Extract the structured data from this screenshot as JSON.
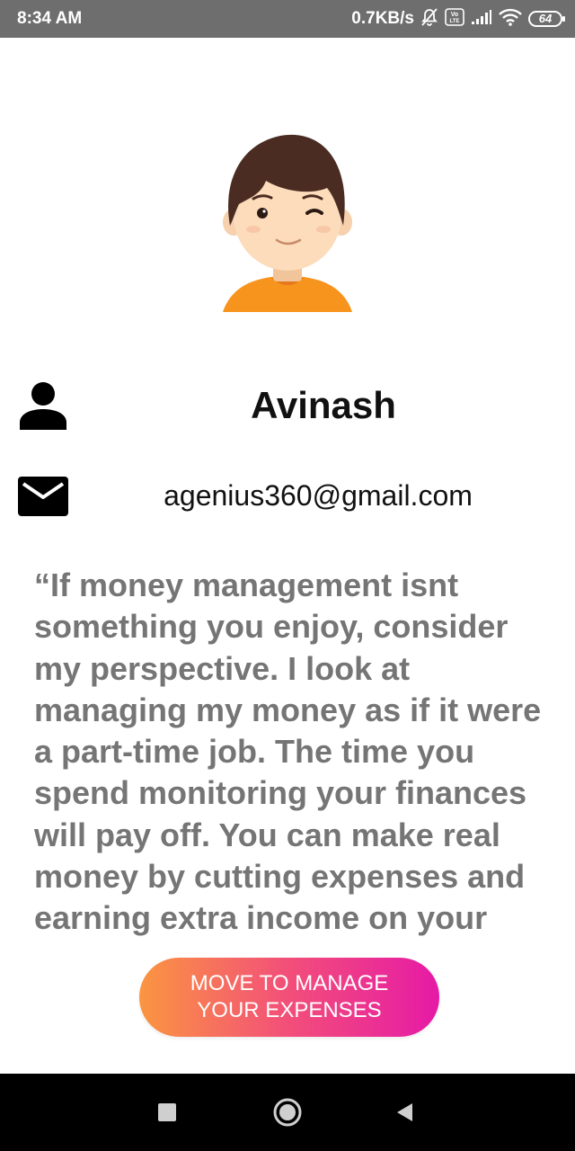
{
  "status_bar": {
    "time": "8:34 AM",
    "network_speed": "0.7KB/s",
    "volte_badge": "VoLTE",
    "battery_level": "64",
    "icons": [
      "mute-notification-icon",
      "volte-icon",
      "signal-icon",
      "wifi-icon",
      "battery-icon"
    ]
  },
  "profile": {
    "avatar_icon": "boy-avatar",
    "name": "Avinash",
    "email": "agenius360@gmail.com",
    "name_icon": "person-icon",
    "email_icon": "mail-icon"
  },
  "quote": {
    "text": "“If money management isnt something you enjoy, consider my perspective. I look at managing my money as if it were a part-time job. The time you spend monitoring your finances will pay off. You can make real money by cutting expenses and earning extra income on your spare time.”"
  },
  "cta": {
    "label": "MOVE TO MANAGE YOUR EXPENSES",
    "gradient": [
      "#fb9541",
      "#f24e7a",
      "#e61aa6"
    ]
  },
  "nav_bar": {
    "buttons": [
      "recents-button",
      "home-button",
      "back-button"
    ]
  },
  "colors": {
    "status_bar_bg": "#6e6e6e",
    "quote_text": "#757575",
    "nav_bar_bg": "#000000"
  }
}
